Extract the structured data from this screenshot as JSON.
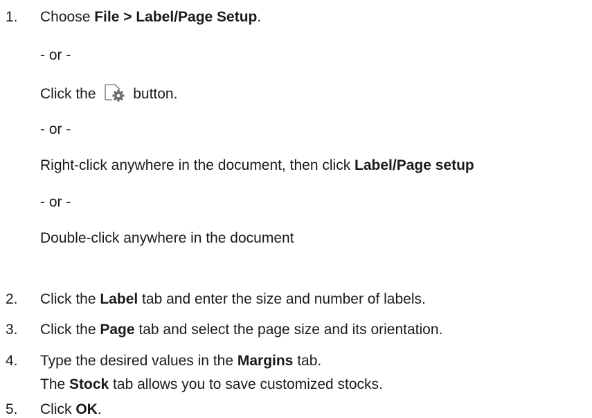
{
  "steps": [
    {
      "number": "1.",
      "main": {
        "prefix": "Choose ",
        "bold": "File > Label/Page Setup",
        "suffix": "."
      },
      "or_1": "- or -",
      "alt_button": {
        "prefix": "Click the",
        "suffix": "button.",
        "icon": "page-setup-gear-icon"
      },
      "or_2": "- or -",
      "alt_rightclick": {
        "prefix": "Right-click anywhere in the document, then click ",
        "bold": "Label/Page setup"
      },
      "or_3": "- or -",
      "alt_doubleclick": "Double-click anywhere in the document"
    },
    {
      "number": "2.",
      "prefix": "Click the ",
      "bold": "Label",
      "suffix": " tab and enter the size and number of labels."
    },
    {
      "number": "3.",
      "prefix": "Click the ",
      "bold": "Page",
      "suffix": " tab and select the page size and its orientation."
    },
    {
      "number": "4.",
      "prefix": "Type the desired values in the ",
      "bold": "Margins",
      "suffix": " tab.",
      "note": {
        "prefix": "The ",
        "bold": "Stock",
        "suffix": " tab allows you to save customized stocks."
      }
    },
    {
      "number": "5.",
      "prefix": "Click ",
      "bold": "OK",
      "suffix": "."
    }
  ],
  "colors": {
    "text": "#1a1a1a",
    "icon_stroke": "#8a8a8a",
    "icon_gear": "#6e6e6e"
  }
}
